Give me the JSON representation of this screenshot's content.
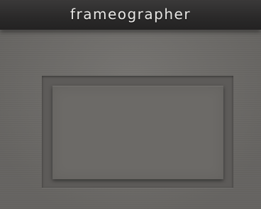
{
  "app": {
    "title": "frameographer"
  },
  "colors": {
    "title_bar": "#2a2929",
    "title_text": "#e9e8e6",
    "background": "#6e6c69",
    "frame_outer": "#5d5b59",
    "frame_inner": "#6c6a67"
  }
}
